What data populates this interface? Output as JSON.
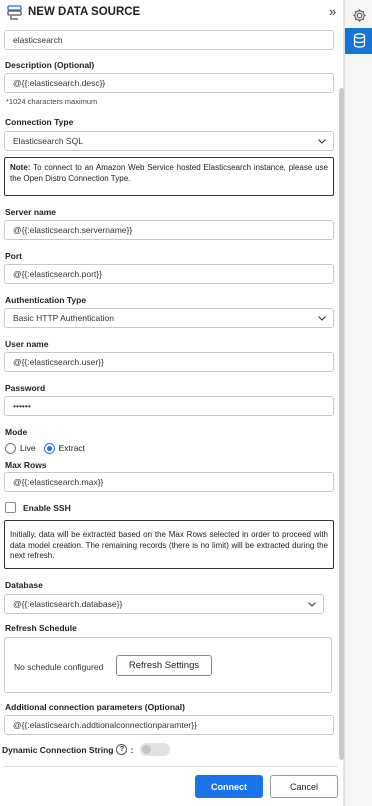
{
  "header": {
    "title": "NEW DATA SOURCE",
    "collapse_glyph": "»",
    "icon": "data-source-icon"
  },
  "rightbar": {
    "icons": [
      "gear-icon",
      "database-icon"
    ],
    "accent": "#1874d2"
  },
  "form": {
    "name_value": "elasticsearch",
    "description": {
      "label": "Description (Optional)",
      "value": "@{{:elasticsearch.desc}}",
      "hint": "*1024 characters maximum"
    },
    "connection_type": {
      "label": "Connection Type",
      "value": "Elasticsearch SQL"
    },
    "note": {
      "bold": "Note:",
      "text": " To connect to an Amazon Web Service hosted Elasticsearch instance, please use the Open Distro Connection Type."
    },
    "server_name": {
      "label": "Server name",
      "value": "@{{:elasticsearch.servername}}"
    },
    "port": {
      "label": "Port",
      "value": "@{{:elasticsearch.port}}"
    },
    "auth_type": {
      "label": "Authentication Type",
      "value": "Basic HTTP Authentication"
    },
    "user_name": {
      "label": "User name",
      "value": "@{{:elasticsearch.user}}"
    },
    "password": {
      "label": "Password",
      "value": "••••••"
    },
    "mode": {
      "label": "Mode",
      "options": [
        "Live",
        "Extract"
      ],
      "selected": "Extract"
    },
    "max_rows": {
      "label": "Max Rows",
      "value": "@{{:elasticsearch.max}}"
    },
    "enable_ssh": {
      "label": "Enable SSH",
      "checked": false
    },
    "extract_note": "Initially, data will be extracted based on the Max Rows selected in order to proceed with data model creation. The remaining records (there is no limit) will be extracted during the next refresh.",
    "database": {
      "label": "Database",
      "value": "@{{:elasticsearch.database}}"
    },
    "refresh_schedule": {
      "label": "Refresh Schedule",
      "status": "No schedule configured",
      "button": "Refresh Settings"
    },
    "additional_params": {
      "label": "Additional connection parameters (Optional)",
      "value": "@{{:elasticsearch.addtionalconnectionparamter}}"
    },
    "dynamic_connection": {
      "label": "Dynamic Connection String",
      "help_glyph": "?",
      "colon": ":",
      "enabled": false
    }
  },
  "footer": {
    "connect": "Connect",
    "cancel": "Cancel",
    "primary_color": "#1a73e8"
  }
}
